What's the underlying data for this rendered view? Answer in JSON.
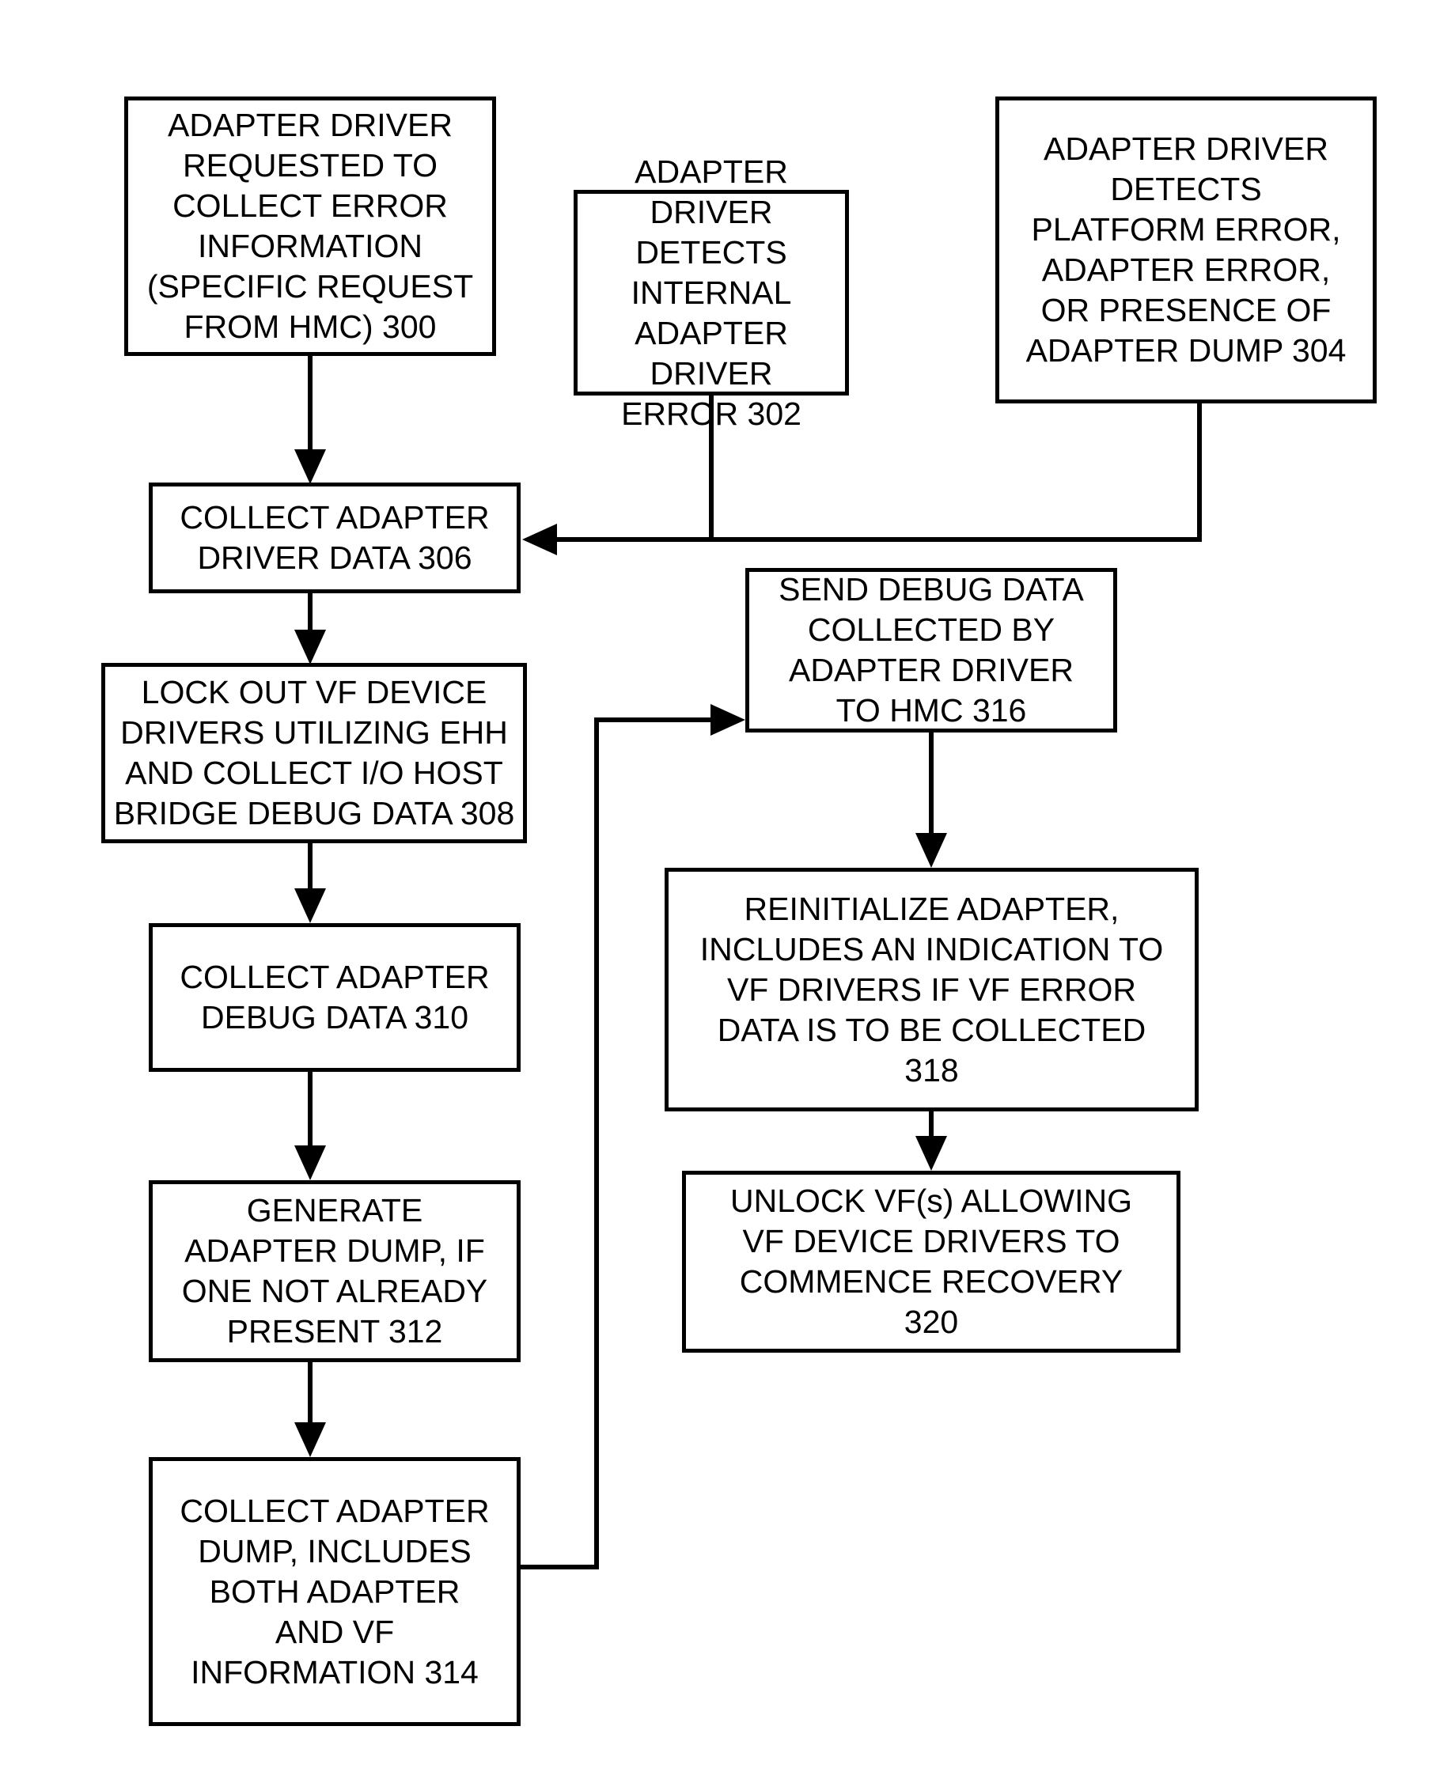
{
  "figure": {
    "type": "flowchart",
    "orientation": "top-to-bottom, two columns",
    "background_color": "#ffffff",
    "line_color": "#000000",
    "text_color": "#000000"
  },
  "nodes": {
    "n300": {
      "ref": "300",
      "text": "ADAPTER DRIVER\nREQUESTED TO\nCOLLECT ERROR\nINFORMATION\n(SPECIFIC REQUEST\nFROM HMC)  300"
    },
    "n302": {
      "ref": "302",
      "text": "ADAPTER DRIVER\nDETECTS INTERNAL\nADAPTER DRIVER\nERROR 302"
    },
    "n304": {
      "ref": "304",
      "text": "ADAPTER DRIVER\nDETECTS\nPLATFORM ERROR,\nADAPTER ERROR,\nOR PRESENCE OF\nADAPTER DUMP 304"
    },
    "n306": {
      "ref": "306",
      "text": "COLLECT ADAPTER\nDRIVER DATA 306"
    },
    "n308": {
      "ref": "308",
      "text": "LOCK OUT VF DEVICE\nDRIVERS UTILIZING EHH\nAND COLLECT I/O HOST\nBRIDGE DEBUG DATA 308"
    },
    "n310": {
      "ref": "310",
      "text": "COLLECT ADAPTER\nDEBUG DATA 310"
    },
    "n312": {
      "ref": "312",
      "text": "GENERATE\nADAPTER DUMP, IF\nONE NOT ALREADY\nPRESENT 312"
    },
    "n314": {
      "ref": "314",
      "text": "COLLECT ADAPTER\nDUMP, INCLUDES\nBOTH ADAPTER\nAND VF\nINFORMATION 314"
    },
    "n316": {
      "ref": "316",
      "text": "SEND DEBUG DATA\nCOLLECTED BY\nADAPTER DRIVER\nTO HMC 316"
    },
    "n318": {
      "ref": "318",
      "text": "REINITIALIZE ADAPTER,\nINCLUDES AN INDICATION TO\nVF DRIVERS IF VF ERROR\nDATA IS TO BE COLLECTED\n318"
    },
    "n320": {
      "ref": "320",
      "text": "UNLOCK VF(s) ALLOWING\nVF DEVICE DRIVERS TO\nCOMMENCE RECOVERY\n320"
    }
  },
  "edges": [
    {
      "id": "e300-306",
      "from": "300",
      "to": "306",
      "style": "straight-down-arrow"
    },
    {
      "id": "e302-306",
      "from": "302",
      "to": "306",
      "style": "down-then-left-arrow"
    },
    {
      "id": "e304-306",
      "from": "304",
      "to": "306",
      "style": "down-then-left-arrow"
    },
    {
      "id": "e306-308",
      "from": "306",
      "to": "308",
      "style": "straight-down-arrow"
    },
    {
      "id": "e308-310",
      "from": "308",
      "to": "310",
      "style": "straight-down-arrow"
    },
    {
      "id": "e310-312",
      "from": "310",
      "to": "312",
      "style": "straight-down-arrow"
    },
    {
      "id": "e312-314",
      "from": "312",
      "to": "314",
      "style": "straight-down-arrow"
    },
    {
      "id": "e314-316",
      "from": "314",
      "to": "316",
      "style": "right-then-up-then-right-arrow"
    },
    {
      "id": "e316-318",
      "from": "316",
      "to": "318",
      "style": "straight-down-arrow"
    },
    {
      "id": "e318-320",
      "from": "318",
      "to": "320",
      "style": "straight-down-arrow"
    }
  ]
}
